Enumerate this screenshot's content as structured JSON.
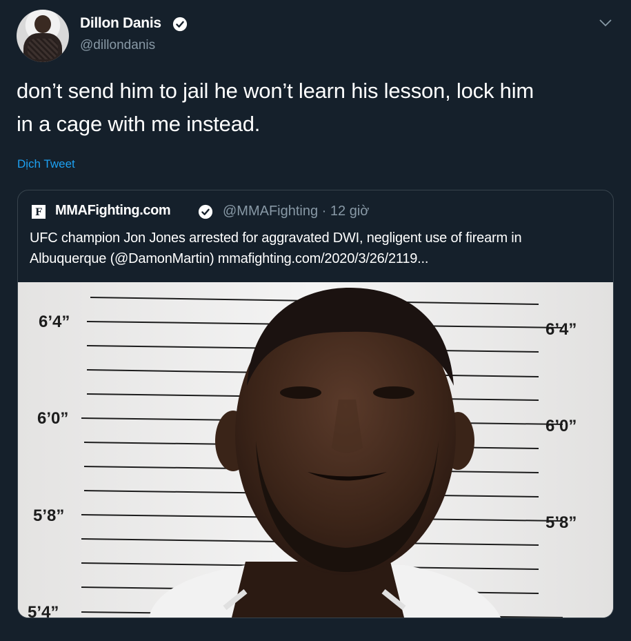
{
  "author": {
    "name": "Dillon Danis",
    "handle": "@dillondanis"
  },
  "tweet": {
    "text_line1": "don’t send him to jail he won’t learn his lesson, lock him",
    "text_line2": "in a cage with me instead.",
    "translate_label": "Dịch Tweet"
  },
  "quoted": {
    "logo_letter": "F",
    "name": "MMAFighting.com",
    "handle_time": "@MMAFighting · 12 giờ",
    "text_line1": "UFC champion Jon Jones arrested for aggravated DWI, negligent use of firearm in",
    "text_line2": "Albuquerque (@DamonMartin) mmafighting.com/2020/3/26/2119..."
  },
  "mugshot": {
    "height_labels_left": [
      "6’4”",
      "6’0”",
      "5’8”",
      "5’4”"
    ],
    "height_labels_right": [
      "6’4”",
      "6’0”",
      "5’8”"
    ]
  },
  "colors": {
    "background": "#15202b",
    "link": "#1da1f2",
    "secondary_text": "#8899a6",
    "verified": "#ffffff"
  },
  "icons": {
    "verified": "verified-badge-icon",
    "caret": "chevron-down-icon"
  }
}
